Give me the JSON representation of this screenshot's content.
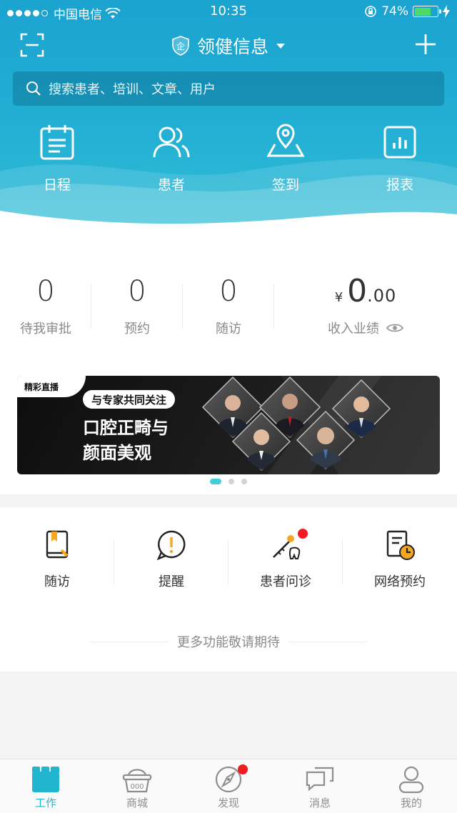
{
  "status_bar": {
    "carrier": "中国电信",
    "time": "10:35",
    "battery": "74%",
    "battery_level": 0.74
  },
  "navbar": {
    "org_badge": "企",
    "org_name": "领健信息"
  },
  "search": {
    "placeholder": "搜索患者、培训、文章、用户"
  },
  "quick_actions": [
    {
      "label": "日程",
      "icon": "calendar-icon"
    },
    {
      "label": "患者",
      "icon": "patients-icon"
    },
    {
      "label": "签到",
      "icon": "location-icon"
    },
    {
      "label": "报表",
      "icon": "chart-icon"
    }
  ],
  "stats": [
    {
      "value": "0",
      "label": "待我审批"
    },
    {
      "value": "0",
      "label": "预约"
    },
    {
      "value": "0",
      "label": "随访"
    }
  ],
  "income": {
    "currency": "¥",
    "integer": "0",
    "decimal": ".00",
    "label": "收入业绩"
  },
  "banner": {
    "tag": "精彩直播",
    "pill": "与专家共同关注",
    "title_line1": "口腔正畸与",
    "title_line2": "颜面美观",
    "pages": 3,
    "active_page": 1
  },
  "tools": [
    {
      "label": "随访",
      "icon": "follow-up-book-icon"
    },
    {
      "label": "提醒",
      "icon": "reminder-alert-icon"
    },
    {
      "label": "患者问诊",
      "icon": "consultation-tooth-icon",
      "badge": true
    },
    {
      "label": "网络预约",
      "icon": "online-booking-icon"
    }
  ],
  "more_text": "更多功能敬请期待",
  "tabbar": [
    {
      "label": "工作",
      "active": true
    },
    {
      "label": "商城",
      "active": false
    },
    {
      "label": "发现",
      "active": false,
      "badge": true
    },
    {
      "label": "消息",
      "active": false
    },
    {
      "label": "我的",
      "active": false
    }
  ],
  "colors": {
    "header": "#1aa3cf",
    "accent": "#21b6d0",
    "badge": "#f01c22",
    "tool_accent": "#f5a623"
  }
}
